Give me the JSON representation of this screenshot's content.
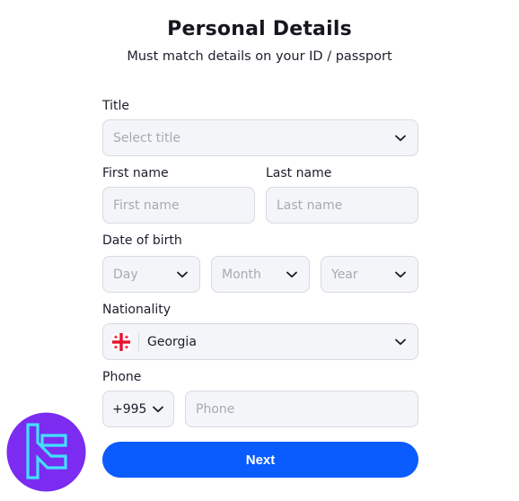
{
  "header": {
    "title": "Personal Details",
    "subtitle": "Must match details on your ID / passport"
  },
  "form": {
    "title_label": "Title",
    "title_placeholder": "Select title",
    "first_name_label": "First name",
    "first_name_placeholder": "First name",
    "last_name_label": "Last name",
    "last_name_placeholder": "Last name",
    "dob_label": "Date of birth",
    "dob_day_placeholder": "Day",
    "dob_month_placeholder": "Month",
    "dob_year_placeholder": "Year",
    "nationality_label": "Nationality",
    "nationality_value": "Georgia",
    "nationality_flag_icon": "georgia-flag-icon",
    "phone_label": "Phone",
    "phone_code_value": "+995",
    "phone_placeholder": "Phone"
  },
  "actions": {
    "next_label": "Next"
  },
  "colors": {
    "accent": "#0a5cff",
    "field_bg": "#f4f5f8",
    "field_border": "#d7dae2",
    "placeholder": "#a6aab5",
    "logo_bg": "#7b2cf0",
    "logo_mark": "#41e0ff",
    "flag_red": "#e8112d"
  }
}
